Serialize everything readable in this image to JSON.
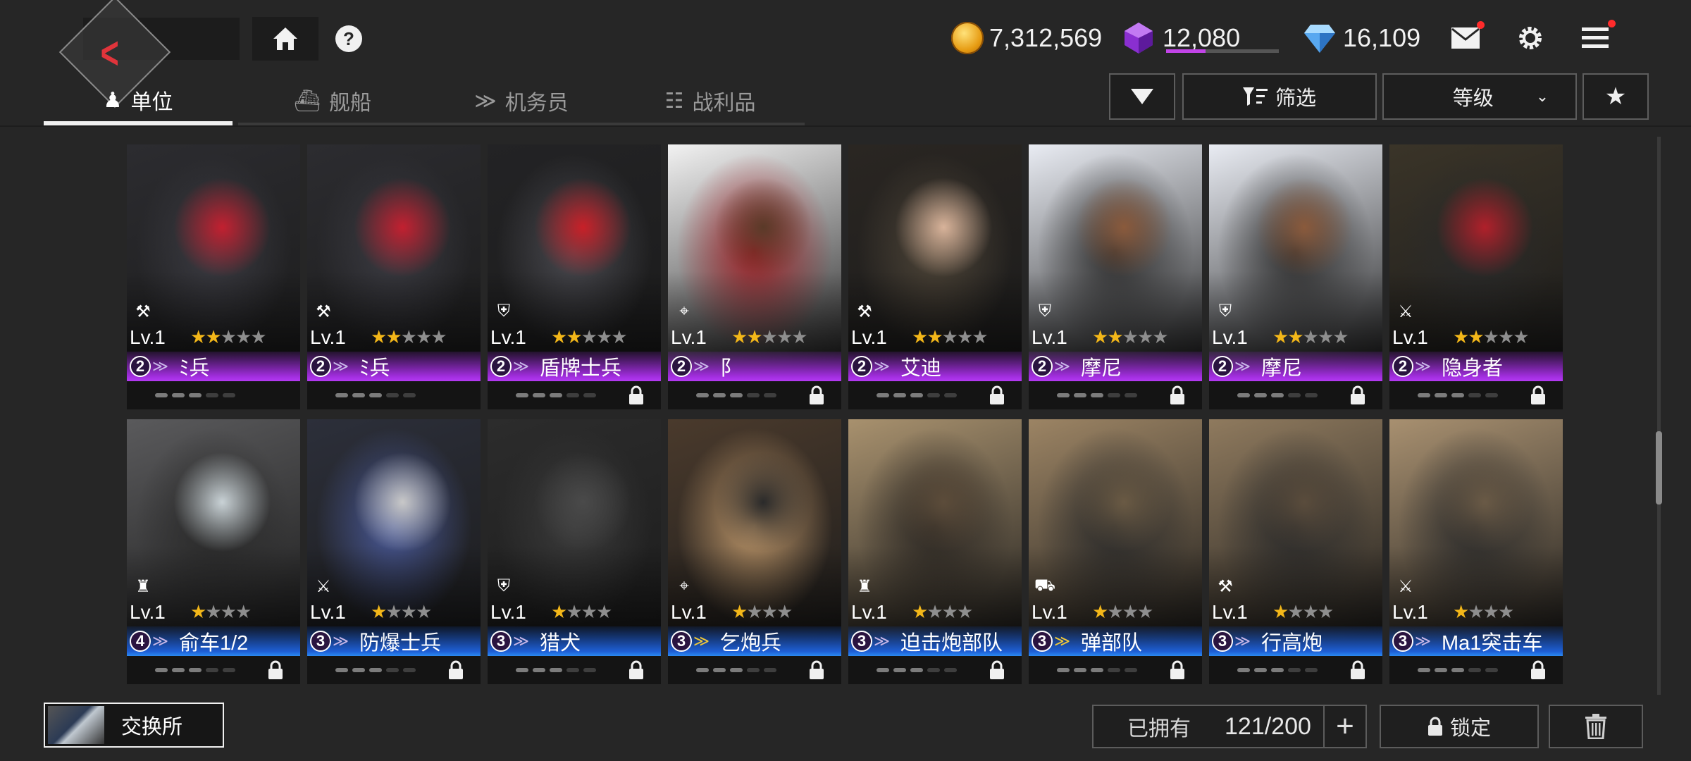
{
  "header": {
    "currencies": [
      {
        "name": "gold",
        "value": "7,312,569"
      },
      {
        "name": "gem",
        "value": "12,080",
        "fill": 0.35
      },
      {
        "name": "crystal",
        "value": "16,109"
      }
    ]
  },
  "tabs": [
    {
      "label": "单位",
      "icon": "unit-icon",
      "active": true
    },
    {
      "label": "舰船",
      "icon": "ship-icon",
      "active": false
    },
    {
      "label": "机务员",
      "icon": "crew-icon",
      "active": false
    },
    {
      "label": "战利品",
      "icon": "loot-icon",
      "active": false
    }
  ],
  "filters": {
    "filter_label": "筛选",
    "sort_label": "等级"
  },
  "units": [
    {
      "lv": "Lv.1",
      "stars": 2,
      "max": 5,
      "rank": "2",
      "name": "ﾐ兵",
      "bar": "purple",
      "locked": false,
      "chev": "normal",
      "role": "gunner-role-icon",
      "palette": [
        "#2c2c30",
        "#3b3b42",
        "#c22030"
      ]
    },
    {
      "lv": "Lv.1",
      "stars": 2,
      "max": 5,
      "rank": "2",
      "name": "ﾐ兵",
      "bar": "purple",
      "locked": false,
      "chev": "normal",
      "role": "gunner-role-icon",
      "palette": [
        "#2c2c30",
        "#3b3b42",
        "#c22030"
      ]
    },
    {
      "lv": "Lv.1",
      "stars": 2,
      "max": 5,
      "rank": "2",
      "name": "盾牌士兵",
      "bar": "purple",
      "locked": true,
      "chev": "normal",
      "role": "defender-role-icon",
      "palette": [
        "#232325",
        "#4a4a50",
        "#c82028"
      ]
    },
    {
      "lv": "Lv.1",
      "stars": 2,
      "max": 5,
      "rank": "2",
      "name": "阝",
      "bar": "purple",
      "locked": true,
      "chev": "normal",
      "role": "sniper-role-icon",
      "palette": [
        "#f2f2f2",
        "#9b1e24",
        "#5a3a28"
      ]
    },
    {
      "lv": "Lv.1",
      "stars": 2,
      "max": 5,
      "rank": "2",
      "name": "艾迪",
      "bar": "purple",
      "locked": true,
      "chev": "normal",
      "role": "gunner-role-icon",
      "palette": [
        "#2a2622",
        "#4e4538",
        "#d8b39a"
      ]
    },
    {
      "lv": "Lv.1",
      "stars": 2,
      "max": 5,
      "rank": "2",
      "name": "摩尼",
      "bar": "purple",
      "locked": true,
      "chev": "normal",
      "role": "defender-role-icon",
      "palette": [
        "#e9ecf3",
        "#2b2b2b",
        "#8a5a3c"
      ]
    },
    {
      "lv": "Lv.1",
      "stars": 2,
      "max": 5,
      "rank": "2",
      "name": "摩尼",
      "bar": "purple",
      "locked": true,
      "chev": "normal",
      "role": "defender-role-icon",
      "palette": [
        "#e9ecf3",
        "#2b2b2b",
        "#8a5a3c"
      ]
    },
    {
      "lv": "Lv.1",
      "stars": 2,
      "max": 5,
      "rank": "2",
      "name": "隐身者",
      "bar": "purple",
      "locked": true,
      "chev": "normal",
      "role": "striker-role-icon",
      "palette": [
        "#3a3428",
        "#2a2a2a",
        "#b0202a"
      ]
    },
    {
      "lv": "Lv.1",
      "stars": 1,
      "max": 4,
      "rank": "4",
      "name": "俞车1/2",
      "bar": "blue",
      "locked": true,
      "chev": "normal",
      "role": "tower-role-icon",
      "palette": [
        "#5a5a5c",
        "#2a2a2a",
        "#c9d2d6"
      ]
    },
    {
      "lv": "Lv.1",
      "stars": 1,
      "max": 4,
      "rank": "3",
      "name": "防爆士兵",
      "bar": "blue",
      "locked": true,
      "chev": "normal",
      "role": "striker-role-icon",
      "palette": [
        "#2c2f3a",
        "#4a5a9a",
        "#c8c8c8"
      ]
    },
    {
      "lv": "Lv.1",
      "stars": 1,
      "max": 4,
      "rank": "3",
      "name": "猎犬",
      "bar": "blue",
      "locked": true,
      "chev": "normal",
      "role": "defender-role-icon",
      "palette": [
        "#2c2c2c",
        "#3a3a3a",
        "#4a4a4a"
      ]
    },
    {
      "lv": "Lv.1",
      "stars": 1,
      "max": 4,
      "rank": "3",
      "name": "乞炮兵",
      "bar": "blue",
      "locked": true,
      "chev": "gold",
      "role": "sniper-role-icon",
      "palette": [
        "#4a3a2c",
        "#c29a6c",
        "#2a2a2a"
      ]
    },
    {
      "lv": "Lv.1",
      "stars": 1,
      "max": 4,
      "rank": "3",
      "name": "迫击炮部队",
      "bar": "blue",
      "locked": true,
      "chev": "normal",
      "role": "tower-role-icon",
      "palette": [
        "#a8916e",
        "#2a2622",
        "#5c4c3a"
      ]
    },
    {
      "lv": "Lv.1",
      "stars": 1,
      "max": 4,
      "rank": "3",
      "name": "弹部队",
      "bar": "blue",
      "locked": true,
      "chev": "gold",
      "role": "vehicle-role-icon",
      "palette": [
        "#9c8464",
        "#2a2a2a",
        "#6a5a44"
      ]
    },
    {
      "lv": "Lv.1",
      "stars": 1,
      "max": 4,
      "rank": "3",
      "name": "行高炮",
      "bar": "blue",
      "locked": true,
      "chev": "normal",
      "role": "gunner-role-icon",
      "palette": [
        "#8f7a5e",
        "#2a2a2a",
        "#5a4c3c"
      ]
    },
    {
      "lv": "Lv.1",
      "stars": 1,
      "max": 4,
      "rank": "3",
      "name": "Ma1突击车",
      "bar": "blue",
      "locked": true,
      "chev": "normal",
      "role": "striker-role-icon",
      "palette": [
        "#a89070",
        "#2a2a2a",
        "#6a5a46"
      ]
    }
  ],
  "footer": {
    "exchange_label": "交换所",
    "owned_label": "已拥有",
    "owned_value": "121/200",
    "plus_label": "+",
    "lock_label": "锁定"
  }
}
